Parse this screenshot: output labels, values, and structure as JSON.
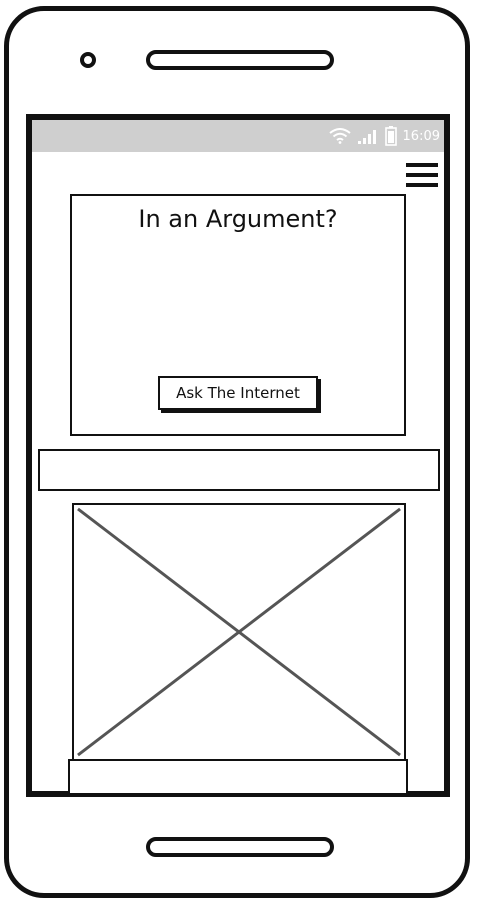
{
  "status_bar": {
    "time": "16:09",
    "icons": [
      "wifi-icon",
      "signal-icon",
      "battery-icon"
    ]
  },
  "header": {
    "menu_icon": "hamburger-menu-icon"
  },
  "hero": {
    "title": "In an Argument?",
    "button_label": "Ask The Internet"
  },
  "placeholders": {
    "image": "image-placeholder"
  },
  "colors": {
    "status_bar_bg": "#cfcfcf",
    "stroke": "#111111",
    "placeholder_cross": "#555555"
  }
}
